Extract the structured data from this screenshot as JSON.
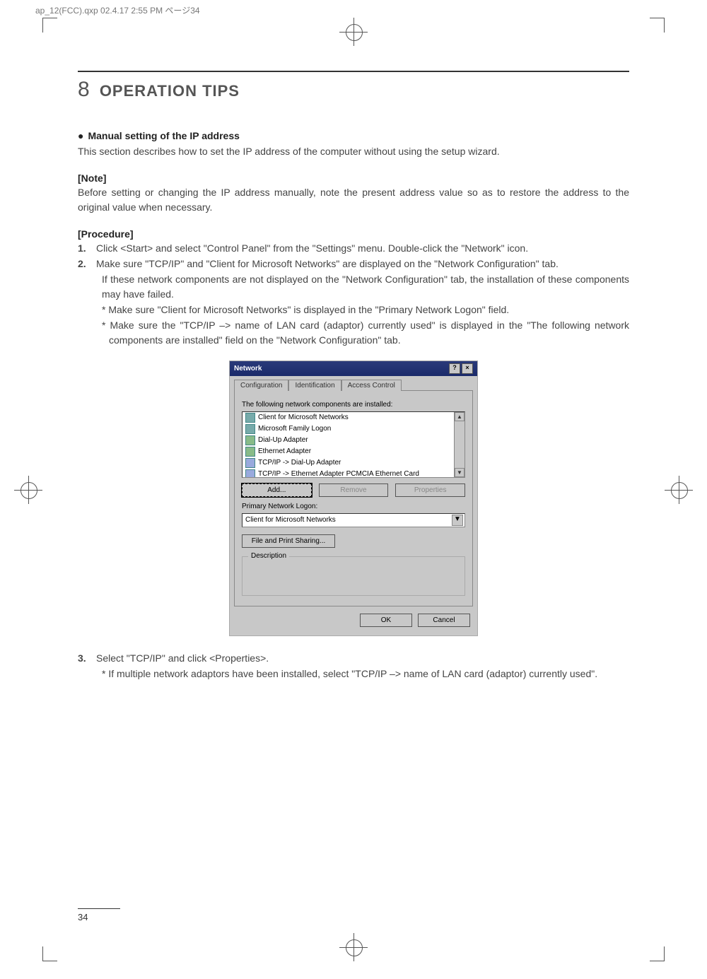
{
  "header_info": "ap_12(FCC).qxp  02.4.17  2:55 PM  ページ34",
  "section": {
    "number": "8",
    "title": "OPERATION TIPS"
  },
  "bullet_heading": "Manual setting of the IP address",
  "intro": "This section describes how to set the IP address of the computer without using the setup wizard.",
  "note_label": "[Note]",
  "note_text": "Before setting or changing the IP address manually, note the present address value so as to restore the address to the original value when necessary.",
  "procedure_label": "[Procedure]",
  "steps": [
    {
      "n": "1.",
      "text": "Click <Start> and select \"Control Panel\" from the \"Settings\" menu. Double-click the \"Network\" icon."
    },
    {
      "n": "2.",
      "text": "Make sure \"TCP/IP\" and \"Client for Microsoft Networks\" are displayed on the \"Network Configuration\" tab.",
      "sub": "If these network components are not displayed on the \"Network Configuration\" tab, the installation of these components may have failed.",
      "stars": [
        "* Make sure \"Client for Microsoft Networks\" is displayed in the \"Primary Network Logon\" field.",
        "* Make sure the \"TCP/IP –> name of LAN card (adaptor) currently used\" is displayed in the \"The following network components are installed\" field on the \"Network Configuration\" tab."
      ]
    },
    {
      "n": "3.",
      "text": "Select \"TCP/IP\" and click <Properties>.",
      "stars": [
        "* If multiple network adaptors have been installed, select \"TCP/IP –> name of LAN card (adaptor) currently used\"."
      ]
    }
  ],
  "dialog": {
    "title": "Network",
    "help": "?",
    "close": "×",
    "tabs": [
      "Configuration",
      "Identification",
      "Access Control"
    ],
    "components_label": "The following network components are installed:",
    "components": [
      "Client for Microsoft Networks",
      "Microsoft Family Logon",
      "Dial-Up Adapter",
      "Ethernet Adapter",
      "TCP/IP -> Dial-Up Adapter",
      "TCP/IP -> Ethernet Adapter PCMCIA Ethernet Card"
    ],
    "add": "Add...",
    "remove": "Remove",
    "properties": "Properties",
    "primary_label": "Primary Network Logon:",
    "primary_value": "Client for Microsoft Networks",
    "file_print": "File and Print Sharing...",
    "description_label": "Description",
    "ok": "OK",
    "cancel": "Cancel",
    "scroll_up": "▲",
    "scroll_down": "▼",
    "combo_arrow": "▼"
  },
  "page_number": "34"
}
